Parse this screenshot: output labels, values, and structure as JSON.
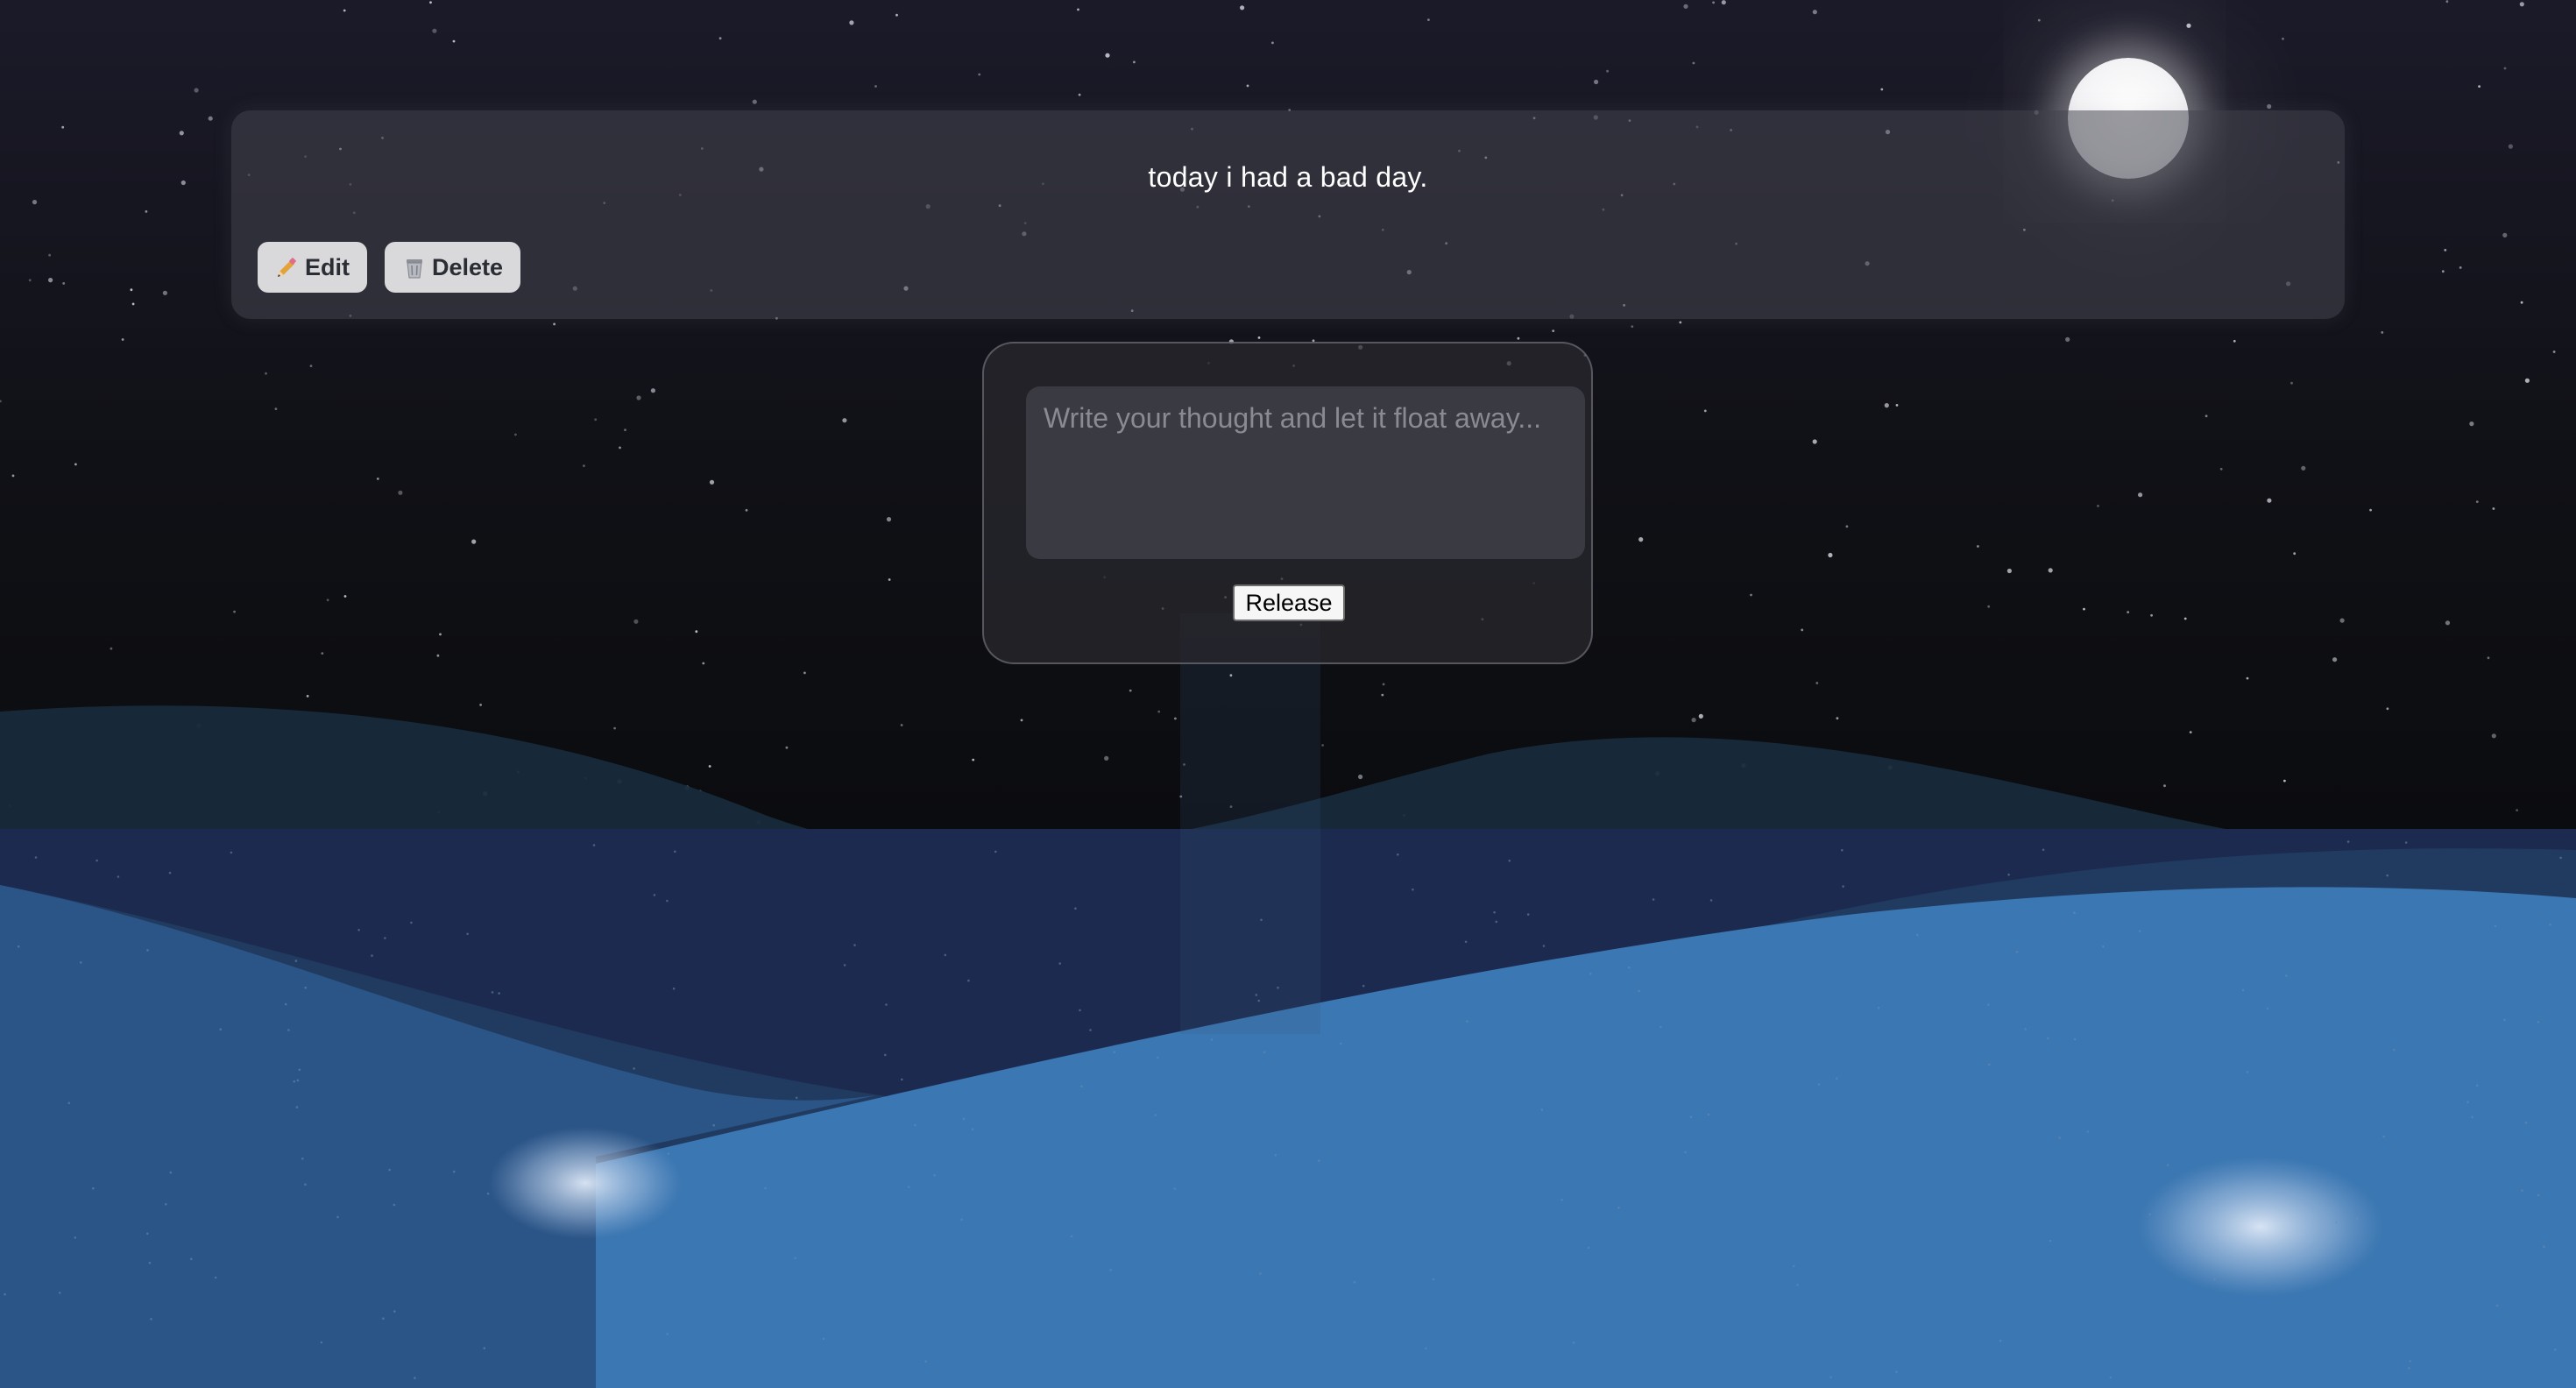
{
  "thought": {
    "text": "today i had a bad day.",
    "edit_label": "Edit",
    "delete_label": "Delete"
  },
  "compose": {
    "placeholder": "Write your thought and let it float away...",
    "value": "",
    "release_label": "Release"
  },
  "colors": {
    "sky_top": "#1b1a29",
    "sky_bottom": "#0b0c0f",
    "sea_dark": "#1a2a4e",
    "sea_mid": "#2a5387",
    "sea_light": "#3b77b2",
    "card_bg": "#46464f",
    "button_bg": "#d9d9dc",
    "moon": "#ffffff"
  },
  "icons": {
    "edit": "pencil-icon",
    "delete": "trash-icon"
  }
}
